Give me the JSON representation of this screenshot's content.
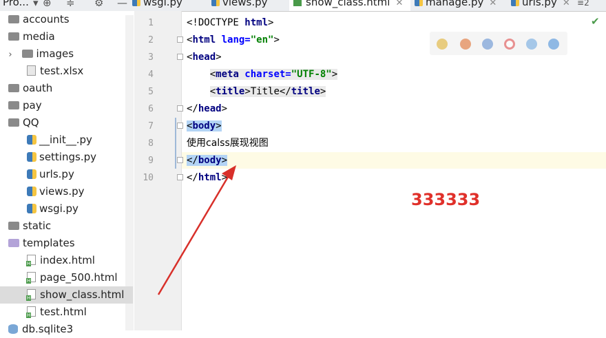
{
  "project_tab": "Pro...",
  "editor_tabs": [
    {
      "label": "wsgi.py",
      "icon": "python-file-icon"
    },
    {
      "label": "views.py",
      "icon": "python-file-icon"
    },
    {
      "label": "show_class.html",
      "icon": "html-file-icon",
      "active": true
    },
    {
      "label": "manage.py",
      "icon": "python-file-icon"
    },
    {
      "label": "urls.py",
      "icon": "python-file-icon"
    }
  ],
  "tab_overflow": "2",
  "tree": [
    {
      "label": "accounts",
      "icon": "folder-icon"
    },
    {
      "label": "media",
      "icon": "folder-icon"
    },
    {
      "label": "images",
      "icon": "folder-icon",
      "collapsed": true
    },
    {
      "label": "test.xlsx",
      "icon": "spreadsheet-file-icon"
    },
    {
      "label": "oauth",
      "icon": "folder-icon"
    },
    {
      "label": "pay",
      "icon": "folder-icon"
    },
    {
      "label": "QQ",
      "icon": "folder-icon"
    },
    {
      "label": "__init__.py",
      "icon": "python-file-icon"
    },
    {
      "label": "settings.py",
      "icon": "python-file-icon"
    },
    {
      "label": "urls.py",
      "icon": "python-file-icon"
    },
    {
      "label": "views.py",
      "icon": "python-file-icon"
    },
    {
      "label": "wsgi.py",
      "icon": "python-file-icon"
    },
    {
      "label": "static",
      "icon": "folder-icon"
    },
    {
      "label": "templates",
      "icon": "folder-icon"
    },
    {
      "label": "index.html",
      "icon": "html-file-icon"
    },
    {
      "label": "page_500.html",
      "icon": "html-file-icon"
    },
    {
      "label": "show_class.html",
      "icon": "html-file-icon",
      "selected": true
    },
    {
      "label": "test.html",
      "icon": "html-file-icon"
    },
    {
      "label": "db.sqlite3",
      "icon": "database-file-icon"
    }
  ],
  "code": {
    "line_numbers": [
      "1",
      "2",
      "3",
      "4",
      "5",
      "6",
      "7",
      "8",
      "9",
      "10"
    ],
    "l1": {
      "open": "<!DOCTYPE ",
      "kw": "html",
      "close": ">"
    },
    "l2": {
      "open": "<",
      "kw": "html",
      "attr": " lang=",
      "val": "\"en\"",
      "close": ">"
    },
    "l3": {
      "open": "<",
      "kw": "head",
      "close": ">"
    },
    "l4": {
      "open": "<",
      "kw": "meta",
      "attr": " charset=",
      "val": "\"UTF-8\"",
      "close": ">"
    },
    "l5": {
      "open": "<",
      "kw": "title",
      "mid": ">Title</",
      "kw2": "title",
      "close": ">"
    },
    "l6": {
      "open": "</",
      "kw": "head",
      "close": ">"
    },
    "l7": {
      "open": "<",
      "kw": "body",
      "close": ">"
    },
    "l8": {
      "text": "使用calss展现视图"
    },
    "l9": {
      "open": "</",
      "kw": "body",
      "close": ">"
    },
    "l10": {
      "open": "</",
      "kw": "html",
      "close": ">"
    }
  },
  "annotation": {
    "text": "333333",
    "color": "#e0302a"
  },
  "colors": {
    "keyword": "#000080",
    "string": "#008000",
    "attribute": "#0000ff",
    "selection": "#b3d4f5",
    "current_line": "#fefbe5"
  }
}
